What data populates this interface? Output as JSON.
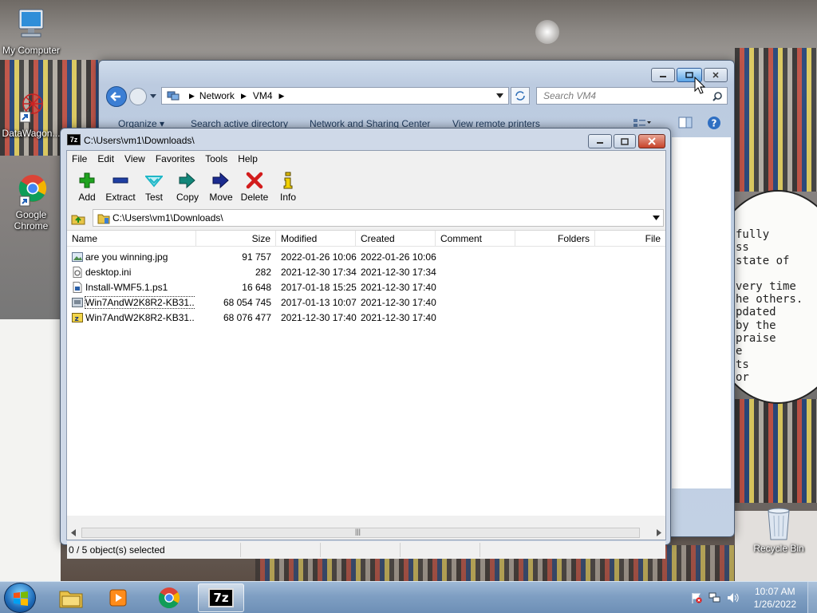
{
  "desktop": {
    "icons": [
      {
        "label": "My Computer",
        "icon": "computer-icon"
      },
      {
        "label": "DataWagon...",
        "icon": "shortcut-icon"
      },
      {
        "label": "Google Chrome",
        "icon": "chrome-icon"
      },
      {
        "label": "Recycle Bin",
        "icon": "recycle-bin-icon"
      }
    ],
    "speech_bubble_lines": [
      "fully",
      "ss",
      "state of",
      "",
      "very time",
      "he others.",
      "pdated",
      "by the",
      "praise",
      "e",
      "ts",
      "or"
    ]
  },
  "explorer": {
    "breadcrumb": [
      "Network",
      "VM4"
    ],
    "search_placeholder": "Search VM4",
    "commands": [
      "Organize ▾",
      "Search active directory",
      "Network and Sharing Center",
      "View remote printers"
    ]
  },
  "sevenzip": {
    "title": "C:\\Users\\vm1\\Downloads\\",
    "app_badge": "7z",
    "menu": [
      "File",
      "Edit",
      "View",
      "Favorites",
      "Tools",
      "Help"
    ],
    "toolbar": [
      {
        "label": "Add",
        "icon": "add-icon",
        "color": "#1fa31f"
      },
      {
        "label": "Extract",
        "icon": "extract-icon",
        "color": "#1f3fa3"
      },
      {
        "label": "Test",
        "icon": "test-icon",
        "color": "#1fb7c7"
      },
      {
        "label": "Copy",
        "icon": "copy-icon",
        "color": "#13877a"
      },
      {
        "label": "Move",
        "icon": "move-icon",
        "color": "#1b2b8f"
      },
      {
        "label": "Delete",
        "icon": "delete-icon",
        "color": "#d21c1c"
      },
      {
        "label": "Info",
        "icon": "info-icon",
        "color": "#d9b700"
      }
    ],
    "path": "C:\\Users\\vm1\\Downloads\\",
    "columns": [
      "Name",
      "Size",
      "Modified",
      "Created",
      "Comment",
      "Folders",
      "File"
    ],
    "files": [
      {
        "name": "are you winning.jpg",
        "size": "91 757",
        "modified": "2022-01-26 10:06",
        "created": "2022-01-26 10:06",
        "icon": "image-file-icon"
      },
      {
        "name": "desktop.ini",
        "size": "282",
        "modified": "2021-12-30 17:34",
        "created": "2021-12-30 17:34",
        "icon": "ini-file-icon"
      },
      {
        "name": "Install-WMF5.1.ps1",
        "size": "16 648",
        "modified": "2017-01-18 15:25",
        "created": "2021-12-30 17:40",
        "icon": "script-file-icon"
      },
      {
        "name": "Win7AndW2K8R2-KB31...",
        "size": "68 054 745",
        "modified": "2017-01-13 10:07",
        "created": "2021-12-30 17:40",
        "icon": "msu-file-icon"
      },
      {
        "name": "Win7AndW2K8R2-KB31...",
        "size": "68 076 477",
        "modified": "2021-12-30 17:40",
        "created": "2021-12-30 17:40",
        "icon": "zip-file-icon"
      }
    ],
    "status": "0 / 5 object(s) selected"
  },
  "taskbar": {
    "pinned": [
      "explorer-icon",
      "media-player-icon",
      "chrome-icon",
      "7zip-icon"
    ],
    "active_index": 3,
    "time": "10:07 AM",
    "date": "1/26/2022"
  }
}
